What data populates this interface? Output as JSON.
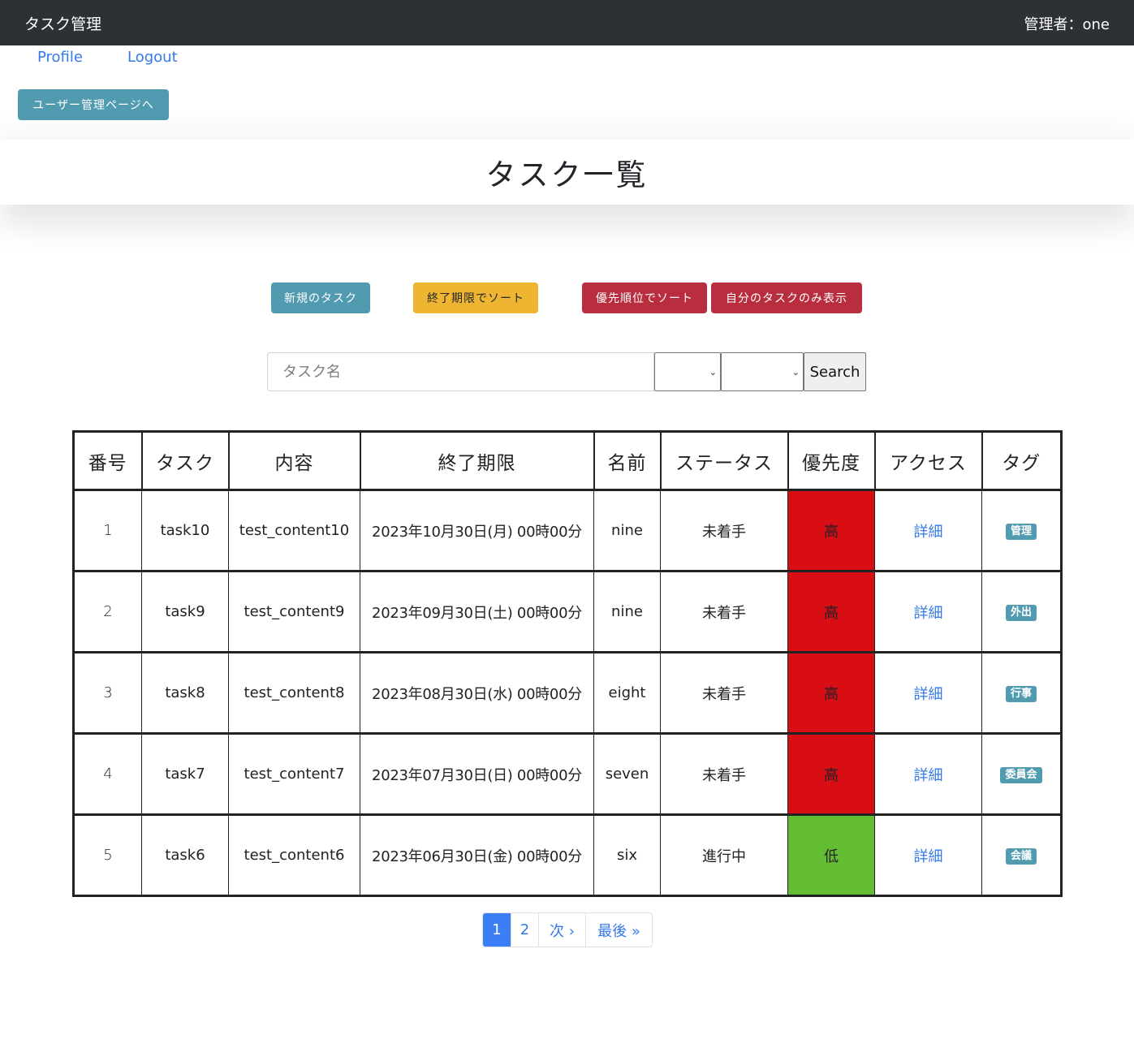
{
  "navbar": {
    "brand": "タスク管理",
    "admin_label": "管理者：one"
  },
  "links": {
    "profile": "Profile",
    "logout": "Logout"
  },
  "user_admin_button": "ユーザー管理ページへ",
  "page_title": "タスク一覧",
  "actions": {
    "new_task": "新規のタスク",
    "sort_deadline": "終了期限でソート",
    "sort_priority": "優先順位でソート",
    "only_mine": "自分のタスクのみ表示"
  },
  "search": {
    "placeholder": "タスク名",
    "value": "",
    "status_select_value": "",
    "tag_select_value": "",
    "button_label": "Search",
    "select_icon": "chevron-down-icon"
  },
  "table": {
    "headers": [
      "番号",
      "タスク",
      "内容",
      "終了期限",
      "名前",
      "ステータス",
      "優先度",
      "アクセス",
      "タグ"
    ],
    "rows": [
      {
        "num": "1",
        "task": "task10",
        "content": "test_content10",
        "deadline": "2023年10月30日(月) 00時00分",
        "name": "nine",
        "status": "未着手",
        "priority": "高",
        "priority_level": "high",
        "access": "詳細",
        "tag": "管理"
      },
      {
        "num": "2",
        "task": "task9",
        "content": "test_content9",
        "deadline": "2023年09月30日(土) 00時00分",
        "name": "nine",
        "status": "未着手",
        "priority": "高",
        "priority_level": "high",
        "access": "詳細",
        "tag": "外出"
      },
      {
        "num": "3",
        "task": "task8",
        "content": "test_content8",
        "deadline": "2023年08月30日(水) 00時00分",
        "name": "eight",
        "status": "未着手",
        "priority": "高",
        "priority_level": "high",
        "access": "詳細",
        "tag": "行事"
      },
      {
        "num": "4",
        "task": "task7",
        "content": "test_content7",
        "deadline": "2023年07月30日(日) 00時00分",
        "name": "seven",
        "status": "未着手",
        "priority": "高",
        "priority_level": "high",
        "access": "詳細",
        "tag": "委員会"
      },
      {
        "num": "5",
        "task": "task6",
        "content": "test_content6",
        "deadline": "2023年06月30日(金) 00時00分",
        "name": "six",
        "status": "進行中",
        "priority": "低",
        "priority_level": "low",
        "access": "詳細",
        "tag": "会議"
      }
    ]
  },
  "pagination": {
    "items": [
      {
        "label": "1",
        "active": true
      },
      {
        "label": "2",
        "active": false
      },
      {
        "label": "次 ›",
        "active": false
      },
      {
        "label": "最後 »",
        "active": false
      }
    ]
  },
  "colors": {
    "navbar_bg": "#2d3035",
    "info": "#519bb0",
    "warning": "#efb532",
    "danger": "#b92e3f",
    "priority_high": "#d90e15",
    "priority_low": "#62bd33",
    "link": "#3579e8",
    "page_active": "#3b7ef5"
  }
}
